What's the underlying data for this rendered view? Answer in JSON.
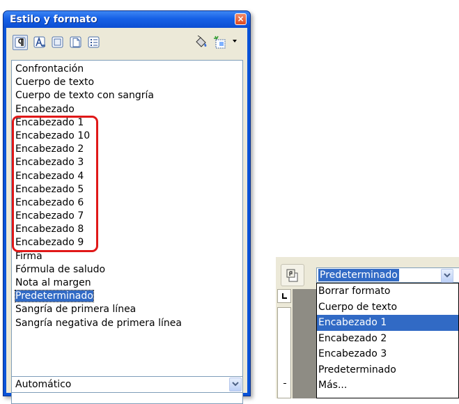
{
  "window": {
    "title": "Estilo y formato",
    "close_label": "×"
  },
  "toolbar": {
    "buttons": [
      {
        "name": "paragraph-styles",
        "icon": "paragraph-styles-icon"
      },
      {
        "name": "character-styles",
        "icon": "character-styles-icon"
      },
      {
        "name": "frame-styles",
        "icon": "frame-styles-icon"
      },
      {
        "name": "page-styles",
        "icon": "page-styles-icon"
      },
      {
        "name": "list-styles",
        "icon": "list-styles-icon"
      },
      {
        "name": "fill-format-mode",
        "icon": "paint-bucket-icon"
      },
      {
        "name": "new-style-from-selection",
        "icon": "new-style-icon"
      }
    ]
  },
  "styles_list": {
    "items": [
      "Confrontación",
      "Cuerpo de texto",
      "Cuerpo de texto con sangría",
      "Encabezado",
      "Encabezado 1",
      "Encabezado 10",
      "Encabezado 2",
      "Encabezado 3",
      "Encabezado 4",
      "Encabezado 5",
      "Encabezado 6",
      "Encabezado 7",
      "Encabezado 8",
      "Encabezado 9",
      "Firma",
      "Fórmula de saludo",
      "Nota al margen",
      "Predeterminado",
      "Sangría de primera línea",
      "Sangría negativa de primera línea"
    ],
    "selected": "Predeterminado"
  },
  "filter_combo": {
    "value": "Automático"
  },
  "style_combo": {
    "value": "Predeterminado",
    "options": [
      "Borrar formato",
      "Cuerpo de texto",
      "Encabezado 1",
      "Encabezado 2",
      "Encabezado 3",
      "Predeterminado",
      "Más..."
    ],
    "highlighted": "Encabezado 1"
  },
  "colors": {
    "title_bar": "#1660e6",
    "selection": "#316ac5",
    "annotation": "#e01818"
  }
}
